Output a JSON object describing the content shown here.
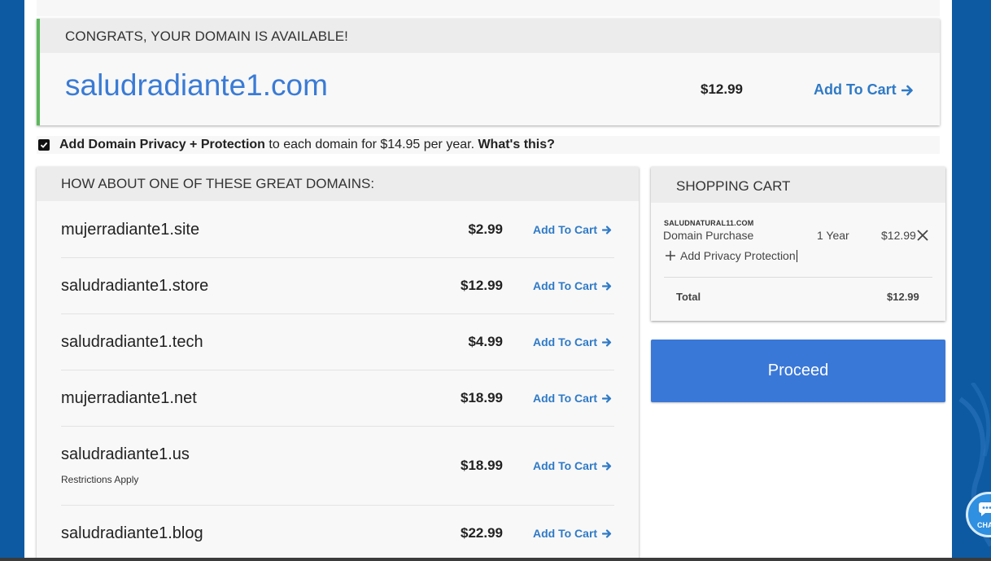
{
  "available": {
    "header": "CONGRATS, YOUR DOMAIN IS AVAILABLE!",
    "domain": "saludradiante1.com",
    "price": "$12.99",
    "add_label": "Add To Cart"
  },
  "privacy": {
    "checked": true,
    "title": "Add Domain Privacy + Protection",
    "text": " to each domain for $14.95 per year. ",
    "link": "What's this?"
  },
  "suggestions": {
    "header": "HOW ABOUT ONE OF THESE GREAT DOMAINS:",
    "items": [
      {
        "domain": "mujerradiante1.site",
        "price": "$2.99",
        "add_label": "Add To Cart",
        "note": ""
      },
      {
        "domain": "saludradiante1.store",
        "price": "$12.99",
        "add_label": "Add To Cart",
        "note": ""
      },
      {
        "domain": "saludradiante1.tech",
        "price": "$4.99",
        "add_label": "Add To Cart",
        "note": ""
      },
      {
        "domain": "mujerradiante1.net",
        "price": "$18.99",
        "add_label": "Add To Cart",
        "note": ""
      },
      {
        "domain": "saludradiante1.us",
        "price": "$18.99",
        "add_label": "Add To Cart",
        "note": "Restrictions Apply"
      },
      {
        "domain": "saludradiante1.blog",
        "price": "$22.99",
        "add_label": "Add To Cart",
        "note": ""
      }
    ]
  },
  "cart": {
    "header": "SHOPPING CART",
    "item_domain": "SALUDNATURAL11.COM",
    "item_type": "Domain Purchase",
    "item_term": "1 Year",
    "item_price": "$12.99",
    "privacy_label": "Add Privacy Protection",
    "total_label": "Total",
    "total_value": "$12.99"
  },
  "proceed_label": "Proceed",
  "chat_label": "CHA",
  "icons": {
    "arrow": "arrow-right-icon",
    "remove": "close-icon",
    "add": "plus-icon",
    "chat": "chat-bubble-icon",
    "check": "checkmark-icon"
  },
  "colors": {
    "background": "#0d5aa3",
    "accent": "#3a7bd5",
    "link": "#2f7ac6",
    "success_border": "#5cb85c",
    "proceed": "#3a78d8"
  }
}
